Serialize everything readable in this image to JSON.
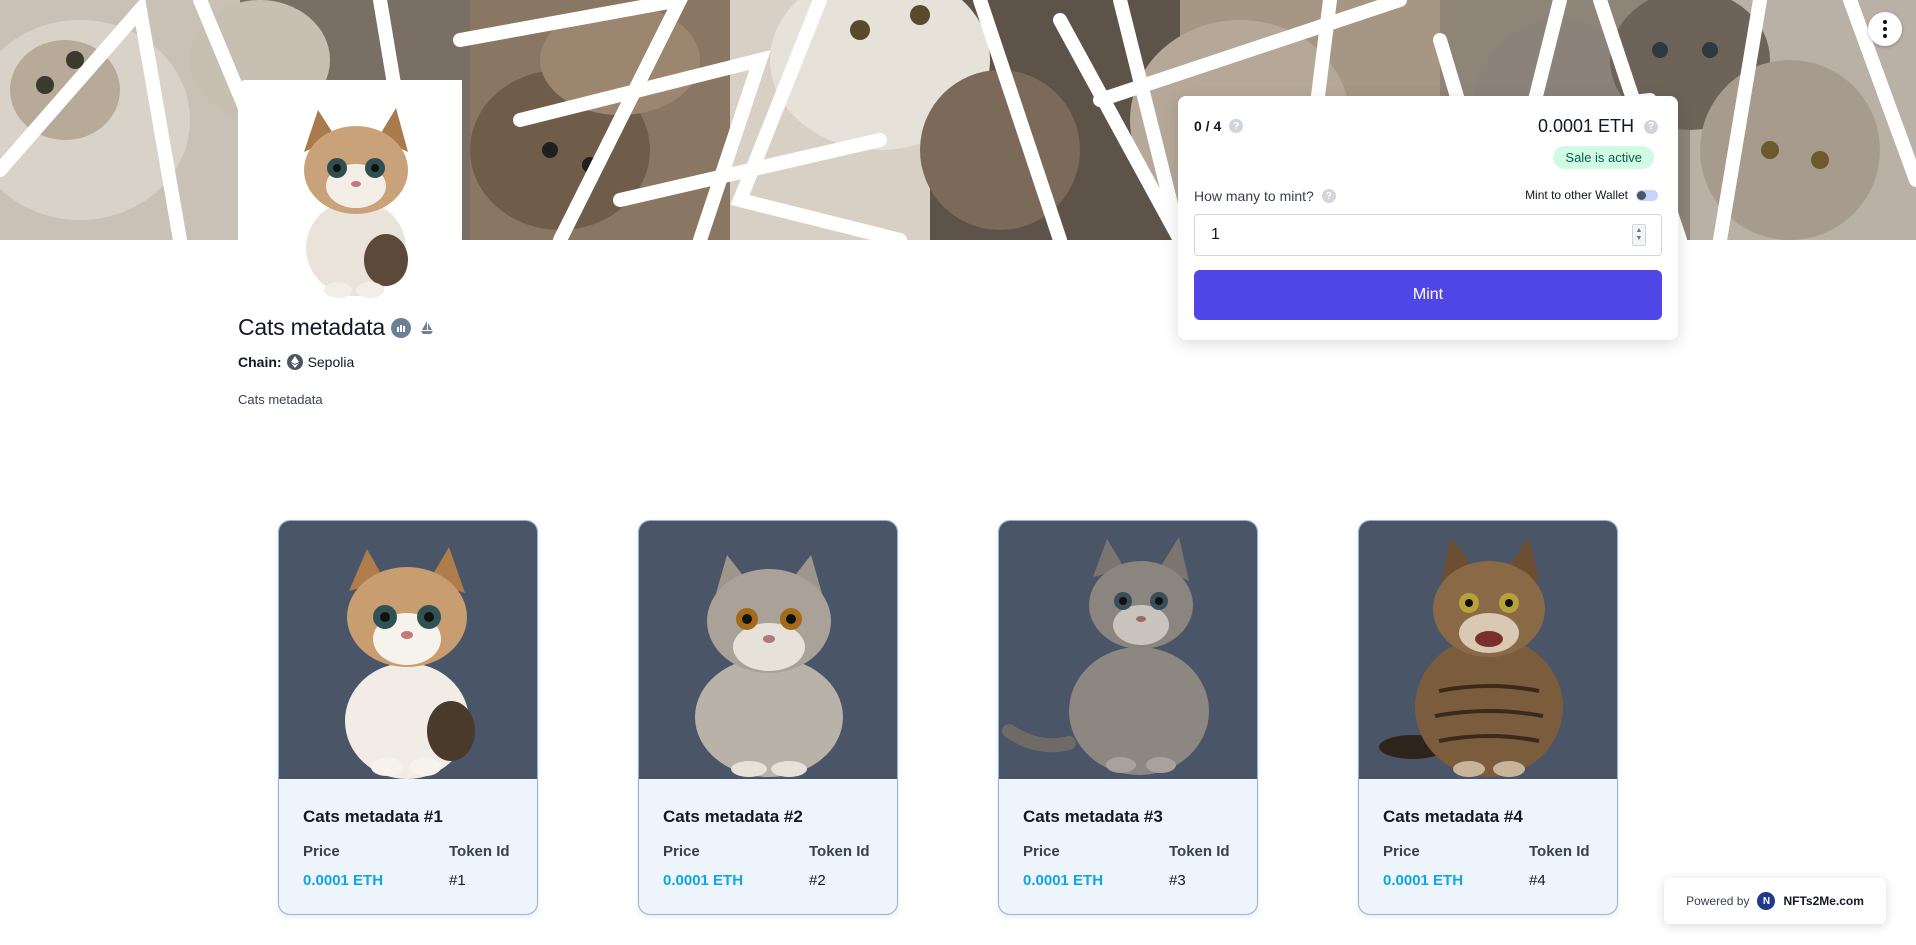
{
  "collection": {
    "title": "Cats metadata",
    "chain_label": "Chain:",
    "chain_name": "Sepolia",
    "description": "Cats metadata"
  },
  "mint": {
    "supply": "0 / 4",
    "price": "0.0001 ETH",
    "sale_status": "Sale is active",
    "quantity_label": "How many to mint?",
    "other_wallet_label": "Mint to other Wallet",
    "other_wallet_enabled": false,
    "quantity_value": "1",
    "button_label": "Mint"
  },
  "tokens": [
    {
      "name": "Cats metadata #1",
      "price_label": "Price",
      "tokenid_label": "Token Id",
      "price": "0.0001 ETH",
      "token_id": "#1"
    },
    {
      "name": "Cats metadata #2",
      "price_label": "Price",
      "tokenid_label": "Token Id",
      "price": "0.0001 ETH",
      "token_id": "#2"
    },
    {
      "name": "Cats metadata #3",
      "price_label": "Price",
      "tokenid_label": "Token Id",
      "price": "0.0001 ETH",
      "token_id": "#3"
    },
    {
      "name": "Cats metadata #4",
      "price_label": "Price",
      "tokenid_label": "Token Id",
      "price": "0.0001 ETH",
      "token_id": "#4"
    }
  ],
  "footer": {
    "powered_by": "Powered by",
    "brand": "NFTs2Me.com"
  },
  "colors": {
    "mint_button": "#4f46e5",
    "price_text": "#0ea5e9",
    "sale_badge_bg": "#d1fae5",
    "card_image_bg": "#4a5568"
  }
}
